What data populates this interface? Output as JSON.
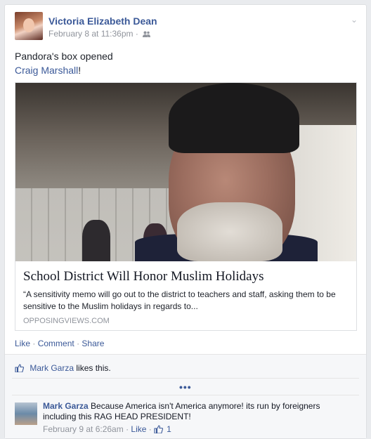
{
  "post": {
    "author": "Victoria Elizabeth Dean",
    "timestamp": "February 8 at 11:36pm",
    "meta_sep": "·",
    "audience_icon": "friends-icon",
    "options_icon": "chevron-down-icon",
    "text_line1": "Pandora's box opened",
    "tagged_name": "Craig Marshall",
    "tagged_suffix": "!",
    "link": {
      "title": "School District Will Honor Muslim Holidays",
      "description": "“A sensitivity memo will go out to the district to teachers and staff, asking them to be sensitive to the Muslim holidays in regards to...",
      "domain": "OPPOSINGVIEWS.COM"
    },
    "actions": {
      "like": "Like",
      "comment": "Comment",
      "share": "Share",
      "sep": "·"
    }
  },
  "likes": {
    "liker": "Mark Garza",
    "suffix": "likes this."
  },
  "more_comments": "•••",
  "comment": {
    "author": "Mark Garza",
    "text": "Because America isn't America anymore! its run by foreigners including this RAG HEAD PRESIDENT!",
    "timestamp": "February 9 at 6:26am",
    "like_label": "Like",
    "like_count": "1",
    "sep": "·"
  },
  "colors": {
    "link": "#3b5998",
    "muted": "#90949c"
  }
}
